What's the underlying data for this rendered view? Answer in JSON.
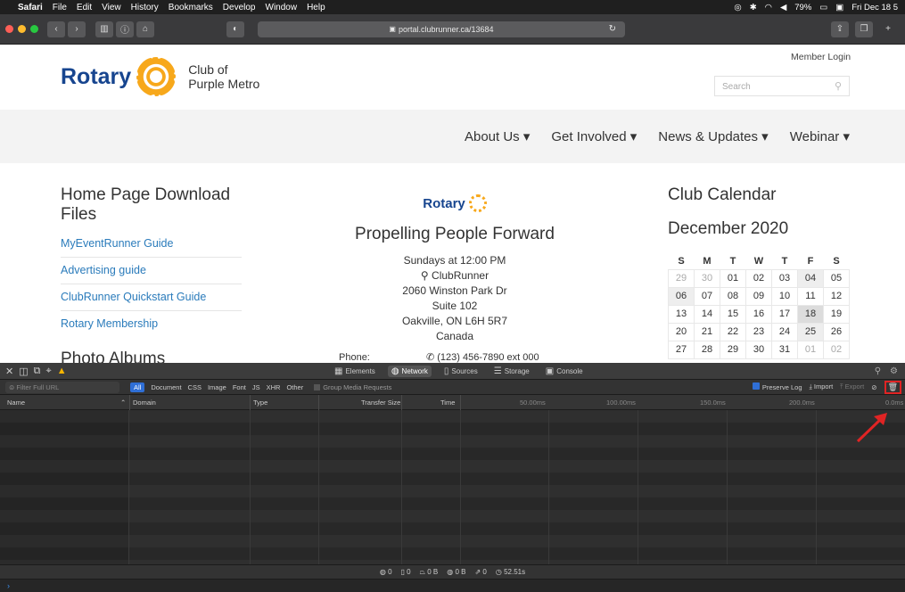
{
  "menubar": {
    "app": "Safari",
    "items": [
      "File",
      "Edit",
      "View",
      "History",
      "Bookmarks",
      "Develop",
      "Window",
      "Help"
    ],
    "battery": "79%",
    "datetime": "Fri Dec 18 5"
  },
  "browser": {
    "url": "portal.clubrunner.ca/13684",
    "traffic_colors": [
      "#ff5f57",
      "#febc2e",
      "#28c840"
    ]
  },
  "site": {
    "logo_word": "Rotary",
    "club_line1": "Club of",
    "club_line2": "Purple Metro",
    "member_login": "Member Login",
    "search_placeholder": "Search",
    "nav": [
      "About Us ▾",
      "Get Involved ▾",
      "News & Updates ▾",
      "Webinar ▾"
    ],
    "files": {
      "title": "Home Page Download Files",
      "items": [
        "MyEventRunner Guide",
        "Advertising guide",
        "ClubRunner Quickstart Guide",
        "Rotary Membership"
      ]
    },
    "albums_title": "Photo Albums",
    "meeting": {
      "logo_word": "Rotary",
      "tagline": "Propelling People Forward",
      "when": "Sundays at 12:00 PM",
      "venue": "ClubRunner",
      "street": "2060 Winston Park Dr",
      "suite": "Suite 102",
      "city": "Oakville, ON L6H 5R7",
      "country": "Canada",
      "phone_label": "Phone:",
      "phone": "(123) 456-7890 ext 000"
    },
    "calendar": {
      "title": "Club Calendar",
      "month": "December 2020",
      "days": [
        "S",
        "M",
        "T",
        "W",
        "T",
        "F",
        "S"
      ],
      "rows": [
        [
          "29",
          "30",
          "01",
          "02",
          "03",
          "04",
          "05"
        ],
        [
          "06",
          "07",
          "08",
          "09",
          "10",
          "11",
          "12"
        ],
        [
          "13",
          "14",
          "15",
          "16",
          "17",
          "18",
          "19"
        ],
        [
          "20",
          "21",
          "22",
          "23",
          "24",
          "25",
          "26"
        ],
        [
          "27",
          "28",
          "29",
          "30",
          "31",
          "01",
          "02"
        ]
      ]
    }
  },
  "devtools": {
    "tabs": [
      "Elements",
      "Network",
      "Sources",
      "Storage",
      "Console"
    ],
    "active_tab": "Network",
    "filter_placeholder": "Filter Full URL",
    "types": [
      "All",
      "Document",
      "CSS",
      "Image",
      "Font",
      "JS",
      "XHR",
      "Other"
    ],
    "group_media": "Group Media Requests",
    "preserve_log": "Preserve Log",
    "import": "Import",
    "export": "Export",
    "columns": [
      "Name",
      "Domain",
      "Type",
      "Transfer Size",
      "Time"
    ],
    "ticks": [
      "50.00ms",
      "100.00ms",
      "150.0ms",
      "200.0ms",
      "0.0ms"
    ],
    "summary": [
      "0",
      "0",
      "0 B",
      "0 B",
      "0",
      "52.51s"
    ],
    "accent": "#e02424"
  }
}
